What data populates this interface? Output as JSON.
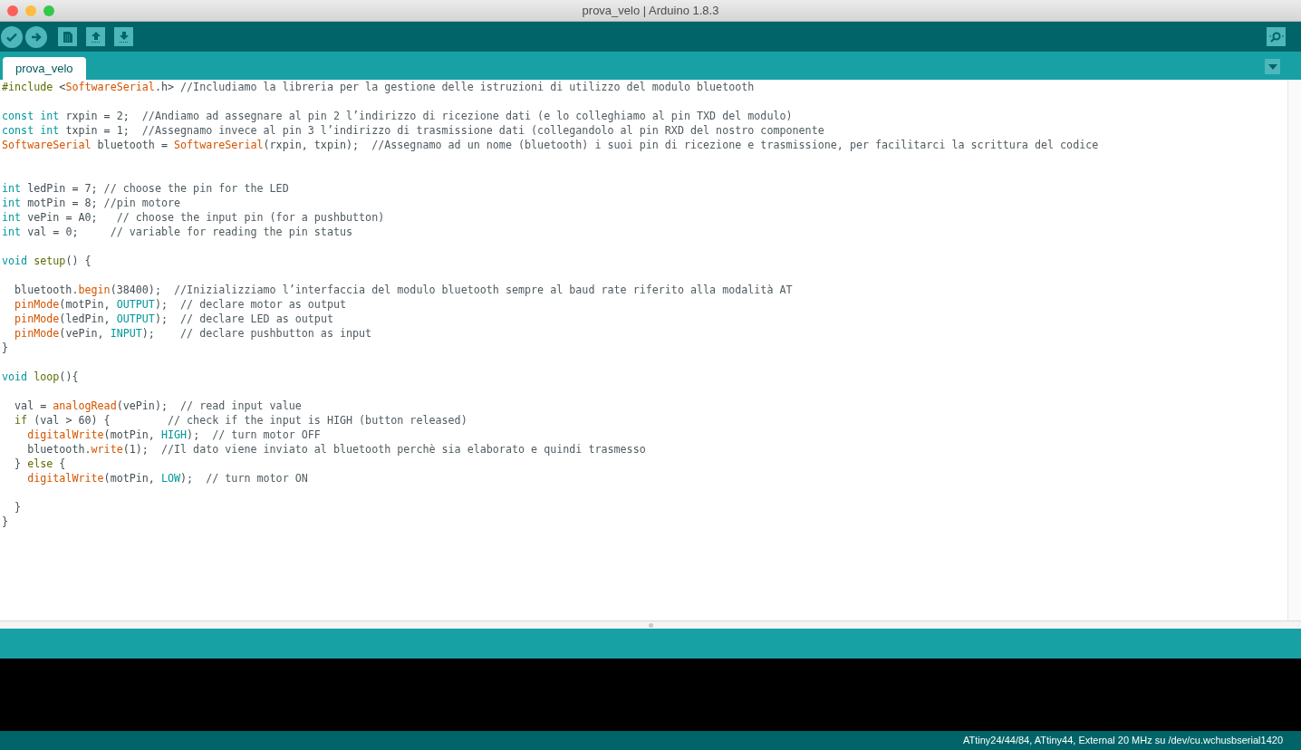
{
  "window": {
    "title": "prova_velo | Arduino 1.8.3"
  },
  "tabs": [
    {
      "label": "prova_velo",
      "selected": true
    }
  ],
  "editor": {
    "lines": [
      {
        "kind": "code",
        "tokens": [
          {
            "kind": "structure",
            "text": "#include"
          },
          {
            "kind": "plain",
            "text": " <"
          },
          {
            "kind": "function",
            "text": "SoftwareSerial"
          },
          {
            "kind": "plain",
            "text": ".h> "
          },
          {
            "kind": "comment",
            "text": "//Includiamo la libreria per la gestione delle istruzioni di utilizzo del modulo bluetooth"
          }
        ]
      },
      {
        "kind": "blank"
      },
      {
        "kind": "code",
        "tokens": [
          {
            "kind": "keyword",
            "text": "const int"
          },
          {
            "kind": "plain",
            "text": " rxpin = 2;  "
          },
          {
            "kind": "comment",
            "text": "//Andiamo ad assegnare al pin 2 l’indirizzo di ricezione dati (e lo colleghiamo al pin TXD del modulo)"
          }
        ]
      },
      {
        "kind": "code",
        "tokens": [
          {
            "kind": "keyword",
            "text": "const int"
          },
          {
            "kind": "plain",
            "text": " txpin = 1;  "
          },
          {
            "kind": "comment",
            "text": "//Assegnamo invece al pin 3 l’indirizzo di trasmissione dati (collegandolo al pin RXD del nostro componente"
          }
        ]
      },
      {
        "kind": "code",
        "tokens": [
          {
            "kind": "function",
            "text": "SoftwareSerial"
          },
          {
            "kind": "plain",
            "text": " bluetooth = "
          },
          {
            "kind": "function",
            "text": "SoftwareSerial"
          },
          {
            "kind": "plain",
            "text": "(rxpin, txpin);  "
          },
          {
            "kind": "comment",
            "text": "//Assegnamo ad un nome (bluetooth) i suoi pin di ricezione e trasmissione, per facilitarci la scrittura del codice"
          }
        ]
      },
      {
        "kind": "blank"
      },
      {
        "kind": "blank"
      },
      {
        "kind": "code",
        "tokens": [
          {
            "kind": "keyword",
            "text": "int"
          },
          {
            "kind": "plain",
            "text": " ledPin = 7; "
          },
          {
            "kind": "comment",
            "text": "// choose the pin for the LED"
          }
        ]
      },
      {
        "kind": "code",
        "tokens": [
          {
            "kind": "keyword",
            "text": "int"
          },
          {
            "kind": "plain",
            "text": " motPin = 8; "
          },
          {
            "kind": "comment",
            "text": "//pin motore"
          }
        ]
      },
      {
        "kind": "code",
        "tokens": [
          {
            "kind": "keyword",
            "text": "int"
          },
          {
            "kind": "plain",
            "text": " vePin = A0;   "
          },
          {
            "kind": "comment",
            "text": "// choose the input pin (for a pushbutton)"
          }
        ]
      },
      {
        "kind": "code",
        "tokens": [
          {
            "kind": "keyword",
            "text": "int"
          },
          {
            "kind": "plain",
            "text": " val = 0;     "
          },
          {
            "kind": "comment",
            "text": "// variable for reading the pin status"
          }
        ]
      },
      {
        "kind": "blank"
      },
      {
        "kind": "code",
        "tokens": [
          {
            "kind": "keyword",
            "text": "void"
          },
          {
            "kind": "structure",
            "text": " setup"
          },
          {
            "kind": "plain",
            "text": "() {"
          }
        ]
      },
      {
        "kind": "blank"
      },
      {
        "kind": "code",
        "tokens": [
          {
            "kind": "plain",
            "text": "  bluetooth."
          },
          {
            "kind": "function",
            "text": "begin"
          },
          {
            "kind": "plain",
            "text": "(38400);  "
          },
          {
            "kind": "comment",
            "text": "//Inizializziamo l’interfaccia del modulo bluetooth sempre al baud rate riferito alla modalità AT"
          }
        ]
      },
      {
        "kind": "code",
        "tokens": [
          {
            "kind": "function",
            "text": "  pinMode"
          },
          {
            "kind": "plain",
            "text": "(motPin, "
          },
          {
            "kind": "keyword",
            "text": "OUTPUT"
          },
          {
            "kind": "plain",
            "text": ");  "
          },
          {
            "kind": "comment",
            "text": "// declare motor as output"
          }
        ]
      },
      {
        "kind": "code",
        "tokens": [
          {
            "kind": "function",
            "text": "  pinMode"
          },
          {
            "kind": "plain",
            "text": "(ledPin, "
          },
          {
            "kind": "keyword",
            "text": "OUTPUT"
          },
          {
            "kind": "plain",
            "text": ");  "
          },
          {
            "kind": "comment",
            "text": "// declare LED as output"
          }
        ]
      },
      {
        "kind": "code",
        "tokens": [
          {
            "kind": "function",
            "text": "  pinMode"
          },
          {
            "kind": "plain",
            "text": "(vePin, "
          },
          {
            "kind": "keyword",
            "text": "INPUT"
          },
          {
            "kind": "plain",
            "text": ");    "
          },
          {
            "kind": "comment",
            "text": "// declare pushbutton as input"
          }
        ]
      },
      {
        "kind": "code",
        "tokens": [
          {
            "kind": "plain",
            "text": "}"
          }
        ]
      },
      {
        "kind": "blank"
      },
      {
        "kind": "code",
        "tokens": [
          {
            "kind": "keyword",
            "text": "void"
          },
          {
            "kind": "structure",
            "text": " loop"
          },
          {
            "kind": "plain",
            "text": "(){"
          }
        ]
      },
      {
        "kind": "blank"
      },
      {
        "kind": "code",
        "tokens": [
          {
            "kind": "plain",
            "text": "  val = "
          },
          {
            "kind": "function",
            "text": "analogRead"
          },
          {
            "kind": "plain",
            "text": "(vePin);  "
          },
          {
            "kind": "comment",
            "text": "// read input value"
          }
        ]
      },
      {
        "kind": "code",
        "tokens": [
          {
            "kind": "structure",
            "text": "  if"
          },
          {
            "kind": "plain",
            "text": " (val > 60) {         "
          },
          {
            "kind": "comment",
            "text": "// check if the input is HIGH (button released)"
          }
        ]
      },
      {
        "kind": "code",
        "tokens": [
          {
            "kind": "function",
            "text": "    digitalWrite"
          },
          {
            "kind": "plain",
            "text": "(motPin, "
          },
          {
            "kind": "keyword",
            "text": "HIGH"
          },
          {
            "kind": "plain",
            "text": ");  "
          },
          {
            "kind": "comment",
            "text": "// turn motor OFF"
          }
        ]
      },
      {
        "kind": "code",
        "tokens": [
          {
            "kind": "plain",
            "text": "    bluetooth."
          },
          {
            "kind": "function",
            "text": "write"
          },
          {
            "kind": "plain",
            "text": "(1);  "
          },
          {
            "kind": "comment",
            "text": "//Il dato viene inviato al bluetooth perchè sia elaborato e quindi trasmesso"
          }
        ]
      },
      {
        "kind": "code",
        "tokens": [
          {
            "kind": "plain",
            "text": "  } "
          },
          {
            "kind": "structure",
            "text": "else"
          },
          {
            "kind": "plain",
            "text": " {"
          }
        ]
      },
      {
        "kind": "code",
        "tokens": [
          {
            "kind": "function",
            "text": "    digitalWrite"
          },
          {
            "kind": "plain",
            "text": "(motPin, "
          },
          {
            "kind": "keyword",
            "text": "LOW"
          },
          {
            "kind": "plain",
            "text": ");  "
          },
          {
            "kind": "comment",
            "text": "// turn motor ON"
          }
        ]
      },
      {
        "kind": "blank"
      },
      {
        "kind": "code",
        "tokens": [
          {
            "kind": "plain",
            "text": "  }"
          }
        ]
      },
      {
        "kind": "code",
        "tokens": [
          {
            "kind": "plain",
            "text": "}"
          }
        ]
      }
    ]
  },
  "status_bar": {
    "board": "ATtiny24/44/84, ATtiny44, External 20 MHz su /dev/cu.wchusbserial1420"
  }
}
